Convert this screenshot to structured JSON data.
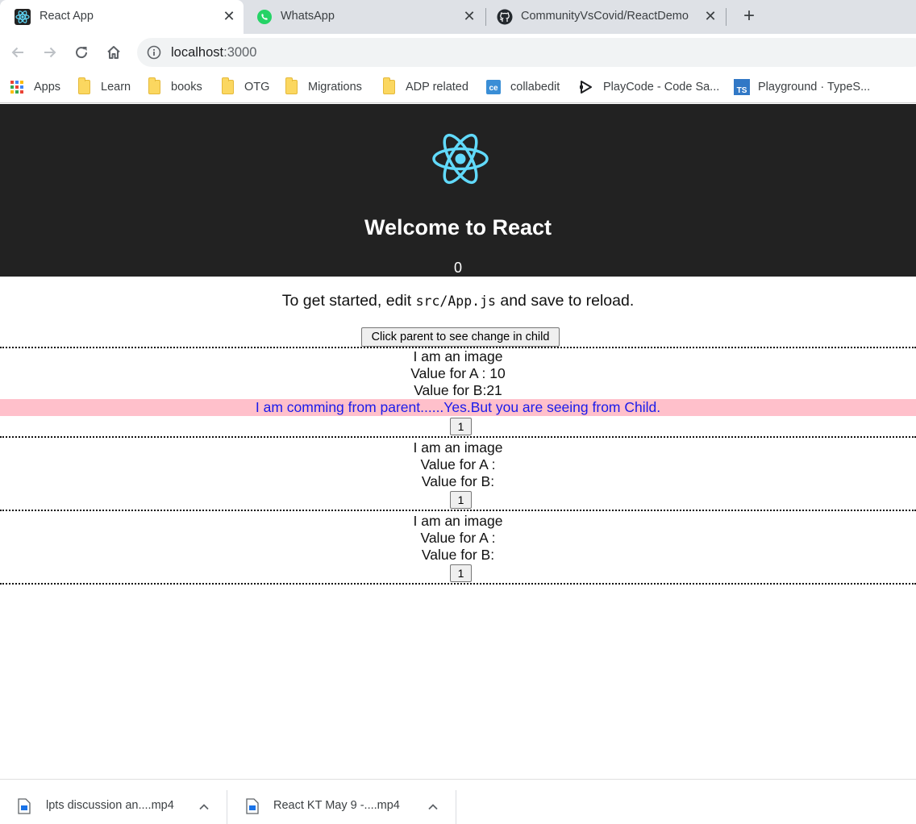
{
  "browser": {
    "tabs": [
      {
        "title": "React App",
        "active": true,
        "icon": "react-icon"
      },
      {
        "title": "WhatsApp",
        "active": false,
        "icon": "whatsapp-icon"
      },
      {
        "title": "CommunityVsCovid/ReactDemo",
        "active": false,
        "icon": "github-icon"
      }
    ],
    "new_tab_label": "+",
    "address": {
      "host": "localhost",
      "port": ":3000"
    },
    "bookmarks": [
      {
        "label": "Apps",
        "icon": "apps-grid-icon"
      },
      {
        "label": "Learn",
        "icon": "folder-icon"
      },
      {
        "label": "books",
        "icon": "folder-icon"
      },
      {
        "label": "OTG",
        "icon": "folder-icon"
      },
      {
        "label": "Migrations",
        "icon": "folder-icon"
      },
      {
        "label": "ADP related",
        "icon": "folder-icon"
      },
      {
        "label": "collabedit",
        "icon": "collabedit-icon"
      },
      {
        "label": "PlayCode - Code Sa...",
        "icon": "playcode-icon"
      },
      {
        "label": "Playground · TypeS...",
        "icon": "typescript-icon"
      }
    ]
  },
  "app": {
    "title": "Welcome to React",
    "count": "0",
    "intro_before": "To get started, edit ",
    "intro_code": "src/App.js",
    "intro_after": " and save to reload.",
    "parent_button": "Click parent to see change in child",
    "children": [
      {
        "image_text": "I am an image",
        "value_a": "Value for A : 10",
        "value_b": "Value for B:21",
        "message": "I am comming from parent......Yes.But you are seeing from Child.",
        "button": "1"
      },
      {
        "image_text": "I am an image",
        "value_a": "Value for A :",
        "value_b": "Value for B:",
        "button": "1"
      },
      {
        "image_text": "I am an image",
        "value_a": "Value for A :",
        "value_b": "Value for B:",
        "button": "1"
      }
    ]
  },
  "downloads": [
    {
      "name": "lpts discussion an....mp4"
    },
    {
      "name": "React KT May 9 -....mp4"
    }
  ],
  "colors": {
    "header_bg": "#222222",
    "react_blue": "#61dafb",
    "message_bg": "#ffc0cb",
    "message_text": "#1b1bea"
  }
}
